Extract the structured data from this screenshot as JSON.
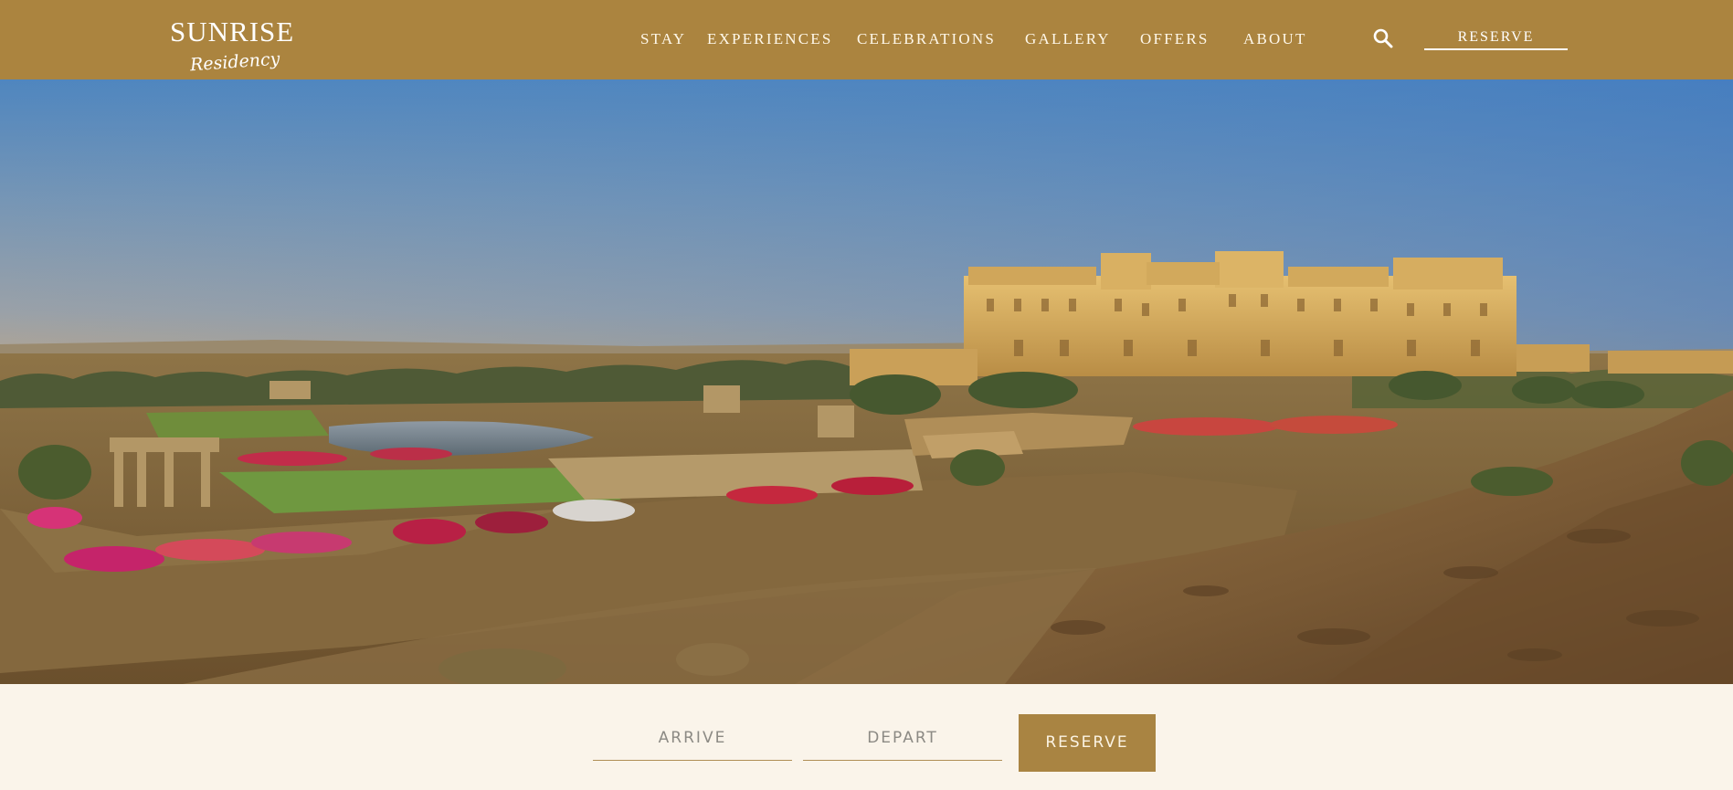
{
  "header": {
    "logo": {
      "title": "SUNRISE",
      "subtitle": "Residency"
    },
    "nav": [
      {
        "label": "STAY"
      },
      {
        "label": "EXPERIENCES"
      },
      {
        "label": "CELEBRATIONS"
      },
      {
        "label": "GALLERY"
      },
      {
        "label": "OFFERS"
      },
      {
        "label": "ABOUT"
      }
    ],
    "search_icon": "search-icon",
    "reserve_label": "RESERVE"
  },
  "hero": {
    "image": "desert-palace-panorama"
  },
  "booking": {
    "arrive_placeholder": "ARRIVE",
    "depart_placeholder": "DEPART",
    "reserve_label": "RESERVE"
  },
  "colors": {
    "header_bg": "#ab843f",
    "page_bg": "#faf4ea",
    "accent": "#a98442",
    "field_text": "#8c8a84"
  }
}
